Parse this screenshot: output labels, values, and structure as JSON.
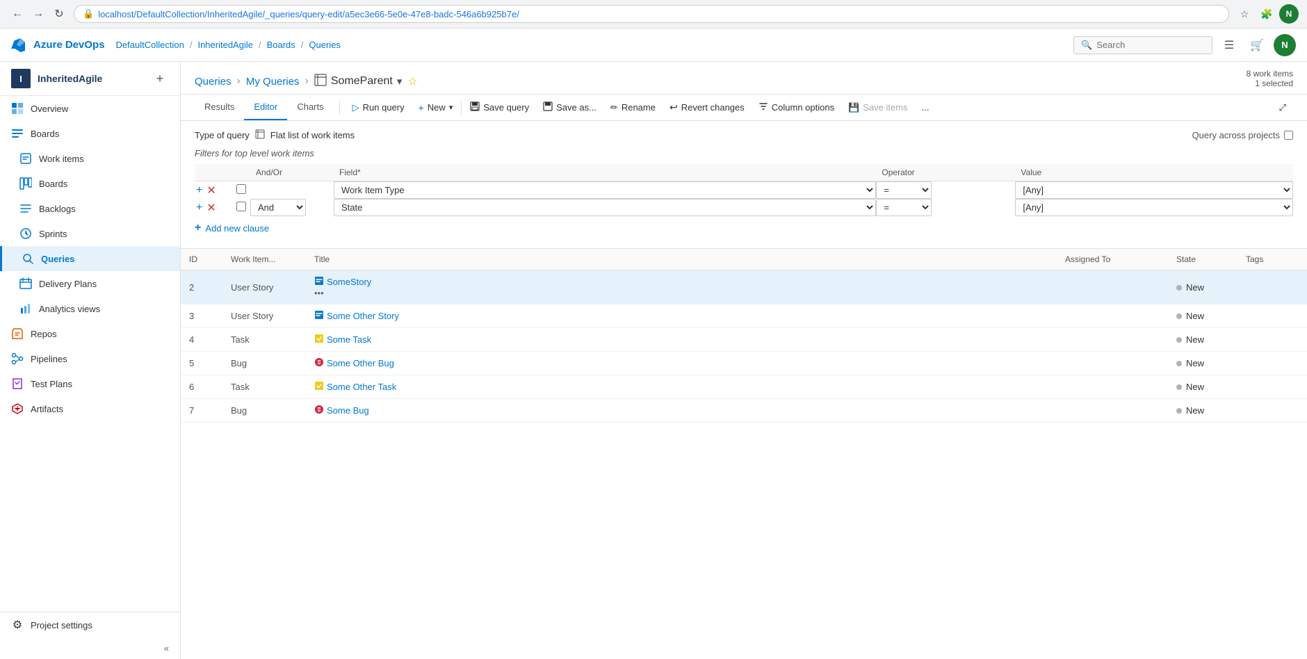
{
  "browser": {
    "url": "localhost/DefaultCollection/InheritedAgile/_queries/query-edit/a5ec3e66-5e0e-47e8-badc-546a6b925b7e/",
    "back_btn": "←",
    "forward_btn": "→",
    "refresh_btn": "↻"
  },
  "top_nav": {
    "logo": "Azure DevOps",
    "breadcrumbs": [
      {
        "label": "DefaultCollection",
        "sep": "/"
      },
      {
        "label": "InheritedAgile",
        "sep": "/"
      },
      {
        "label": "Boards",
        "sep": "/"
      },
      {
        "label": "Queries",
        "sep": ""
      }
    ],
    "search_placeholder": "Search",
    "user_initial": "N"
  },
  "sidebar": {
    "org_icon": "I",
    "org_name": "InheritedAgile",
    "nav_items": [
      {
        "id": "overview",
        "label": "Overview",
        "icon": "🏠"
      },
      {
        "id": "boards",
        "label": "Boards",
        "icon": "📋",
        "section": "Boards"
      },
      {
        "id": "work-items",
        "label": "Work items",
        "icon": "📄"
      },
      {
        "id": "boards-sub",
        "label": "Boards",
        "icon": "⊞"
      },
      {
        "id": "backlogs",
        "label": "Backlogs",
        "icon": "☰"
      },
      {
        "id": "sprints",
        "label": "Sprints",
        "icon": "⟳"
      },
      {
        "id": "queries",
        "label": "Queries",
        "icon": "🔍",
        "active": true
      },
      {
        "id": "delivery-plans",
        "label": "Delivery Plans",
        "icon": "📅"
      },
      {
        "id": "analytics-views",
        "label": "Analytics views",
        "icon": "📊"
      },
      {
        "id": "repos",
        "label": "Repos",
        "icon": "🗂"
      },
      {
        "id": "pipelines",
        "label": "Pipelines",
        "icon": "⚙"
      },
      {
        "id": "test-plans",
        "label": "Test Plans",
        "icon": "🧪"
      },
      {
        "id": "artifacts",
        "label": "Artifacts",
        "icon": "📦"
      }
    ],
    "project_settings": "Project settings",
    "collapse_icon": "«"
  },
  "page": {
    "breadcrumb_queries": "Queries",
    "breadcrumb_my_queries": "My Queries",
    "title": "SomeParent",
    "work_items_count": "8 work items",
    "selected_count": "1 selected",
    "tabs": [
      {
        "id": "results",
        "label": "Results"
      },
      {
        "id": "editor",
        "label": "Editor",
        "active": true
      },
      {
        "id": "charts",
        "label": "Charts"
      }
    ],
    "toolbar": {
      "run_query": "Run query",
      "new": "New",
      "save_query": "Save query",
      "save_as": "Save as...",
      "rename": "Rename",
      "revert_changes": "Revert changes",
      "column_options": "Column options",
      "save_items": "Save items",
      "more": "..."
    },
    "query_type_label": "Type of query",
    "query_type_value": "Flat list of work items",
    "query_across_label": "Query across projects",
    "filters_label": "Filters for top level work items",
    "filter_columns": {
      "and_or": "And/Or",
      "field": "Field*",
      "operator": "Operator",
      "value": "Value"
    },
    "filter_rows": [
      {
        "and_or": "",
        "field": "Work Item Type",
        "operator": "=",
        "value": "[Any]"
      },
      {
        "and_or": "And",
        "field": "State",
        "operator": "=",
        "value": "[Any]"
      }
    ],
    "add_clause_label": "Add new clause",
    "results_columns": [
      "ID",
      "Work Item...",
      "Title",
      "Assigned To",
      "State",
      "Tags"
    ],
    "results_rows": [
      {
        "id": "2",
        "type": "User Story",
        "type_icon": "user-story",
        "title": "SomeStory",
        "assigned_to": "",
        "state": "New",
        "tags": "",
        "has_actions": true,
        "selected": true
      },
      {
        "id": "3",
        "type": "User Story",
        "type_icon": "user-story",
        "title": "Some Other Story",
        "assigned_to": "",
        "state": "New",
        "tags": "",
        "has_actions": false,
        "selected": false
      },
      {
        "id": "4",
        "type": "Task",
        "type_icon": "task",
        "title": "Some Task",
        "assigned_to": "",
        "state": "New",
        "tags": "",
        "has_actions": false,
        "selected": false
      },
      {
        "id": "5",
        "type": "Bug",
        "type_icon": "bug",
        "title": "Some Other Bug",
        "assigned_to": "",
        "state": "New",
        "tags": "",
        "has_actions": false,
        "selected": false
      },
      {
        "id": "6",
        "type": "Task",
        "type_icon": "task",
        "title": "Some Other Task",
        "assigned_to": "",
        "state": "New",
        "tags": "",
        "has_actions": false,
        "selected": false
      },
      {
        "id": "7",
        "type": "Bug",
        "type_icon": "bug",
        "title": "Some Bug",
        "assigned_to": "",
        "state": "New",
        "tags": "",
        "has_actions": false,
        "selected": false
      }
    ]
  }
}
